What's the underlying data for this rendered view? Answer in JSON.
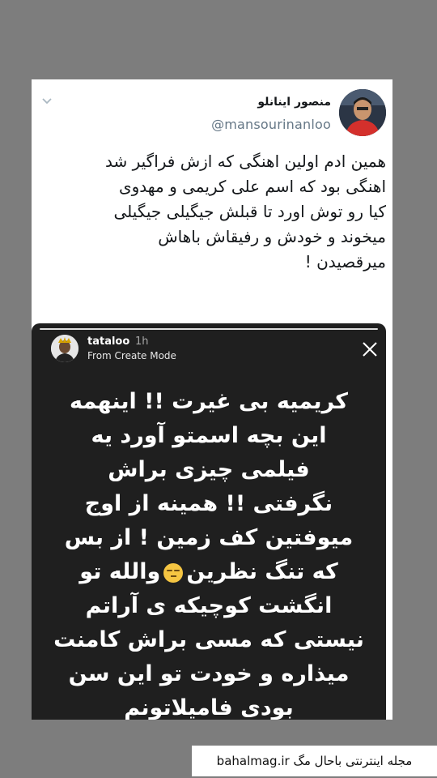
{
  "tweet": {
    "author_name": "منصور اینانلو",
    "author_handle": "@mansourinanloo",
    "body_lines": [
      "همین ادم اولین اهنگی که ازش فراگیر شد",
      "اهنگی بود که اسم علی کریمی و مهدوی",
      "کیا رو توش اورد تا قبلش جیگیلی جیگیلی",
      "میخوند و خودش و رفیقاش باهاش",
      "میرقصیدن !"
    ]
  },
  "story": {
    "username": "tataloo",
    "time": "1h",
    "subtitle": "From Create Mode",
    "text_lines": [
      "کریمیه بی غیرت !! اینهمه",
      "این بچه اسمتو آورد یه",
      "فیلمی چیزی براش",
      "نگرفتی !! همینه از اوج",
      "میوفتین کف زمین ! از بس",
      "که تنگ نظرین",
      "والله تو",
      "انگشت کوچیکه ی آراتم",
      "نیستی که مسی براش کامنت",
      "میذاره و خودت تو این سن",
      "بودی فامیلاتونم"
    ]
  },
  "watermark": {
    "text": "مجله اینترنتی باحال مگ bahalmag.ir"
  },
  "icons": {
    "caret": "chevron-down-icon",
    "close": "close-icon",
    "emoji": "unamused-face-emoji"
  },
  "colors": {
    "background": "#7d7d7d",
    "card": "#ffffff",
    "story_bg": "#1f1f1f",
    "handle": "#657786"
  }
}
